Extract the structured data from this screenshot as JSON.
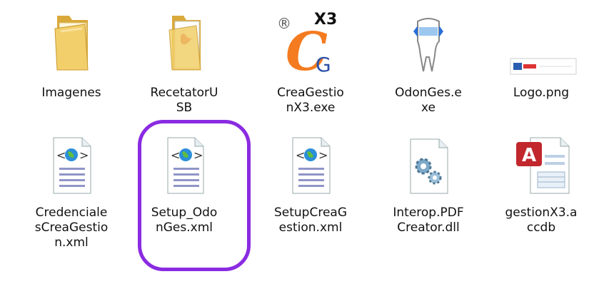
{
  "row1": [
    {
      "name": "Imagenes",
      "label_lines": [
        "Imagenes"
      ],
      "icon": "folder-icon"
    },
    {
      "name": "RecetatorUSB",
      "label_lines": [
        "RecetatorU",
        "SB"
      ],
      "icon": "folder-pdf-icon"
    },
    {
      "name": "CreaGestionX3.exe",
      "label_lines": [
        "CreaGestio",
        "nX3.exe"
      ],
      "icon": "creagestion-app-icon",
      "icon_text": {
        "mark": "®",
        "letter": "C",
        "sub": "G",
        "sup": "X3"
      }
    },
    {
      "name": "OdonGes.exe",
      "label_lines": [
        "OdonGes.e",
        "xe"
      ],
      "icon": "tooth-app-icon"
    },
    {
      "name": "Logo.png",
      "label_lines": [
        "Logo.png"
      ],
      "icon": "image-thumbnail-icon"
    }
  ],
  "row2": [
    {
      "name": "CredencialesCreaGestion.xml",
      "label_lines": [
        "Credenciale",
        "sCreaGestio",
        "n.xml"
      ],
      "icon": "xml-file-icon"
    },
    {
      "name": "Setup_OdonGes.xml",
      "label_lines": [
        "Setup_Odo",
        "nGes.xml"
      ],
      "icon": "xml-file-icon",
      "highlighted": true
    },
    {
      "name": "SetupCreaGestion.xml",
      "label_lines": [
        "SetupCreaG",
        "estion.xml"
      ],
      "icon": "xml-file-icon"
    },
    {
      "name": "Interop.PDFCreator.dll",
      "label_lines": [
        "Interop.PDF",
        "Creator.dll"
      ],
      "icon": "dll-gear-icon"
    },
    {
      "name": "gestionX3.accdb",
      "label_lines": [
        "gestionX3.a",
        "ccdb"
      ],
      "icon": "access-db-icon",
      "icon_text": {
        "letter": "A"
      }
    }
  ],
  "colors": {
    "highlight": "#8a2be2",
    "folder": "#f2cf6b",
    "access": "#c1272d",
    "creagestion_orange": "#f47b20"
  }
}
